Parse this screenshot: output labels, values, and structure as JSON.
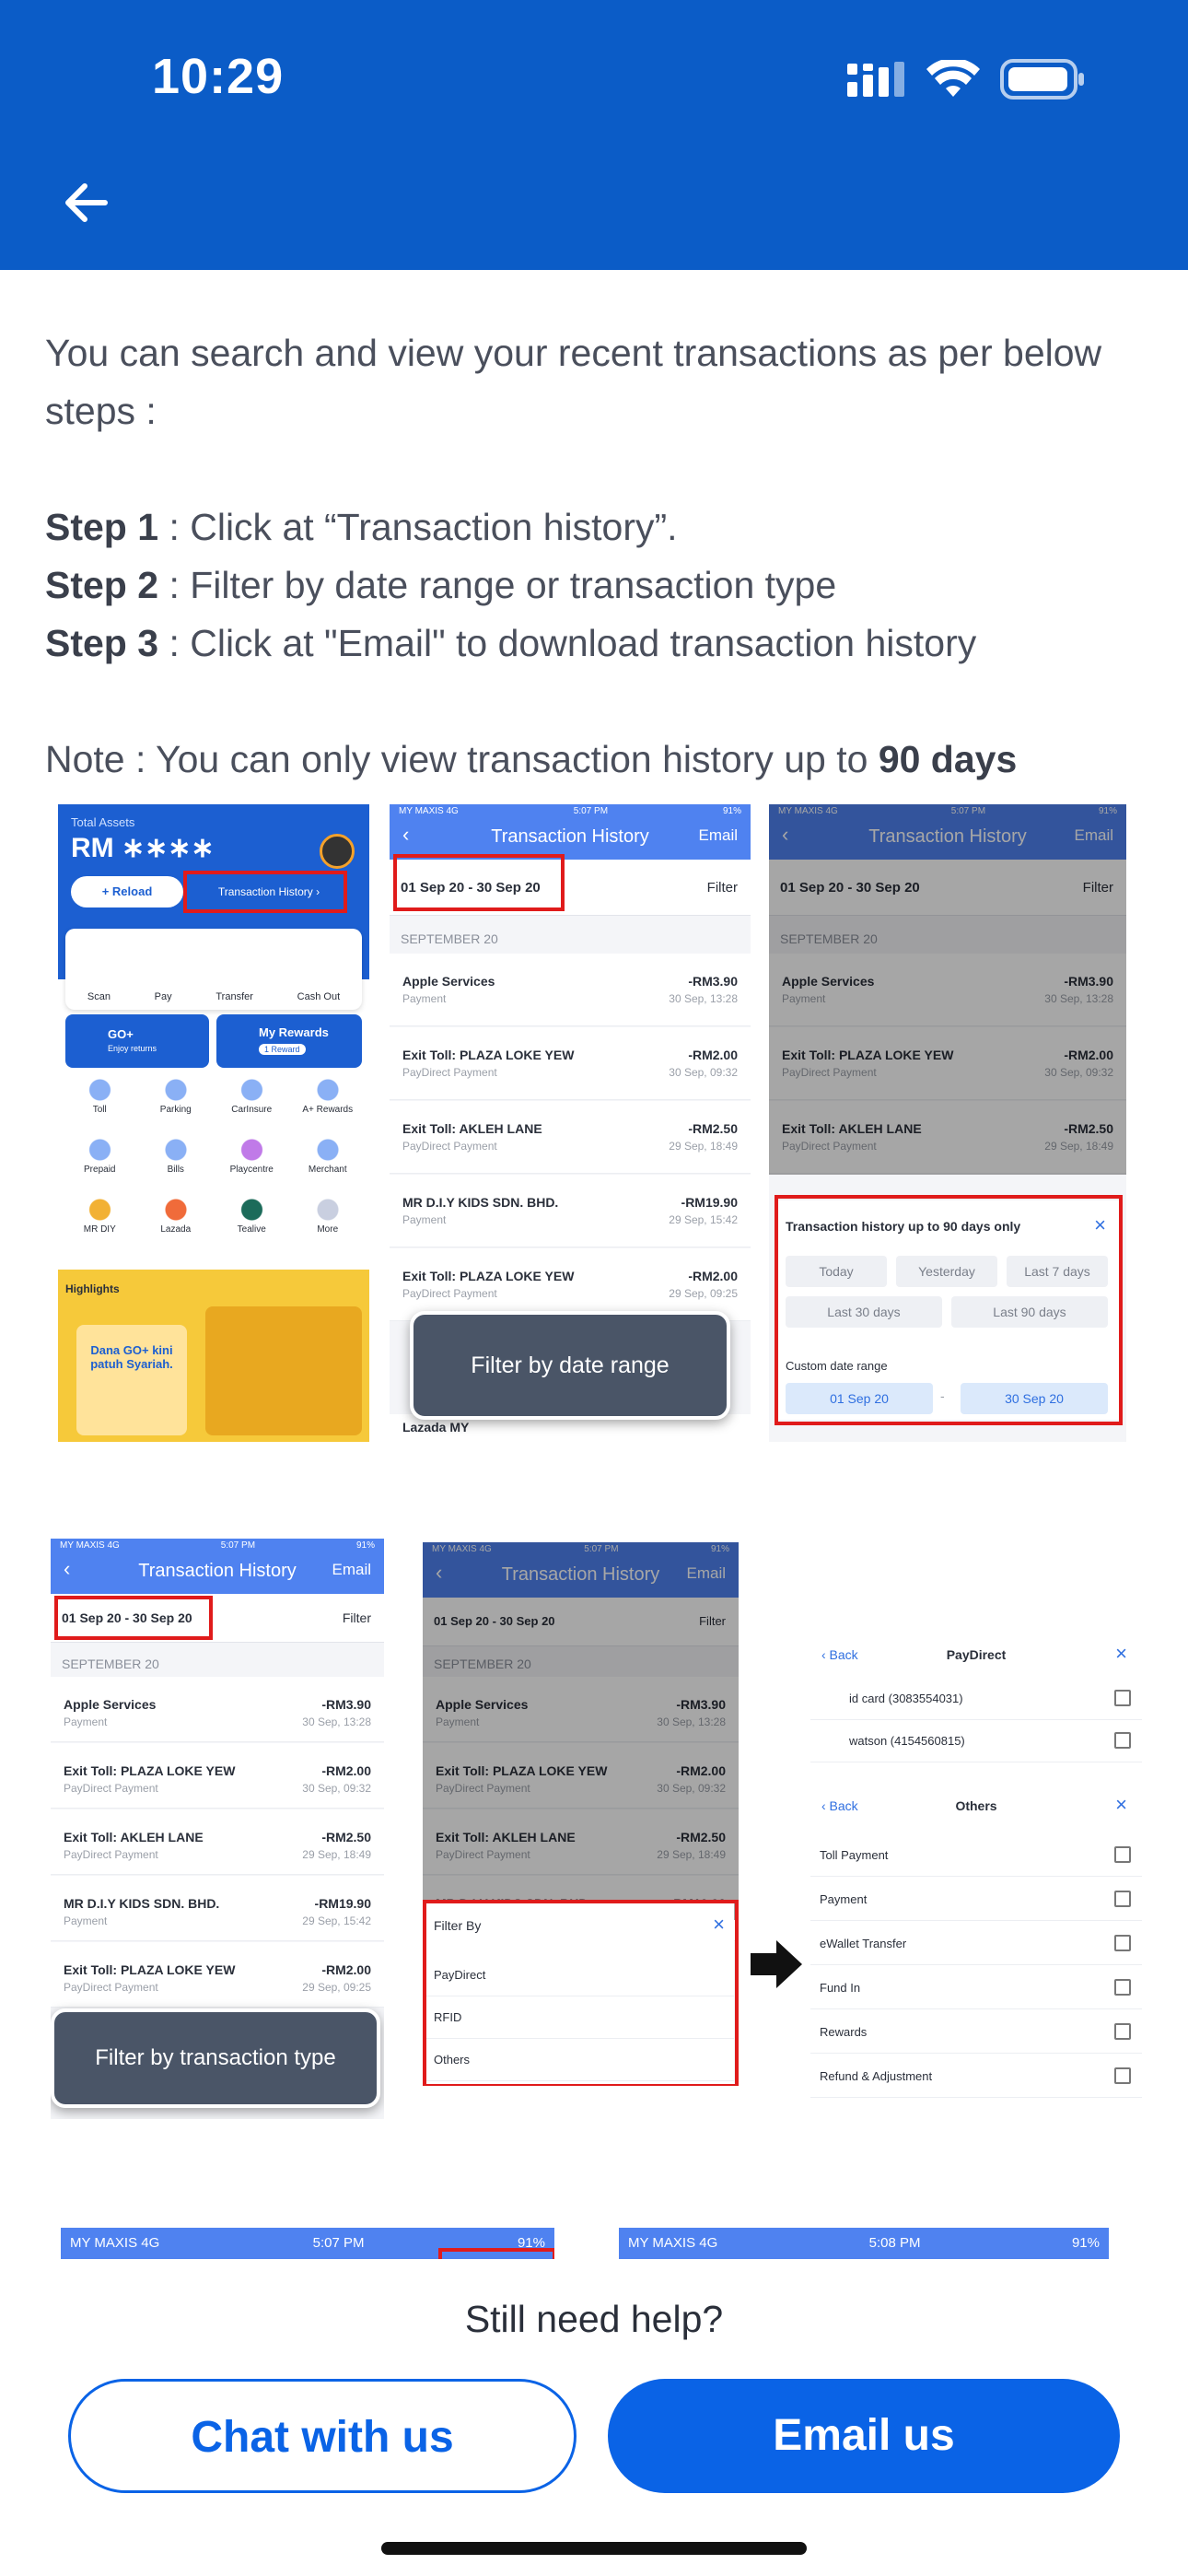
{
  "status_bar": {
    "time": "10:29"
  },
  "intro": "You can search and view your recent transactions as per below steps :",
  "steps": [
    {
      "label": "Step 1",
      "text": " : Click at “Transaction history”."
    },
    {
      "label": "Step 2",
      "text": " : Filter by date range or transaction type"
    },
    {
      "label": "Step 3",
      "text": " : Click at \"Email\" to download transaction history"
    }
  ],
  "note": {
    "text": "Note : You can only view transaction history up to ",
    "bold": "90 days"
  },
  "shot1": {
    "total_assets": "Total Assets",
    "balance": "RM ∗∗∗∗",
    "reload": "+ Reload",
    "history_link": "Transaction History ›",
    "actions": [
      "Scan",
      "Pay",
      "Transfer",
      "Cash Out"
    ],
    "goplus": "GO+",
    "goplus_sub": "Enjoy returns",
    "rewards": "My Rewards",
    "rewards_badge": "1 Reward",
    "grid": [
      "Toll",
      "Parking",
      "CarInsure",
      "A+ Rewards",
      "Prepaid",
      "Bills",
      "Playcentre",
      "Merchant",
      "MR DIY",
      "Lazada",
      "Tealive",
      "More"
    ],
    "highlights": "Highlights",
    "banner": "Dana GO+ kini patuh Syariah."
  },
  "history": {
    "carrier": "MY MAXIS  4G",
    "clock": "5:07 PM",
    "battery": "91%",
    "title": "Transaction History",
    "email": "Email",
    "date_range": "01 Sep 20 - 30 Sep 20",
    "filter": "Filter",
    "section": "SEPTEMBER 20",
    "rows": [
      {
        "name": "Apple Services",
        "sub": "Payment",
        "amount": "-RM3.90",
        "time": "30 Sep, 13:28"
      },
      {
        "name": "Exit Toll: PLAZA LOKE YEW",
        "sub": "PayDirect Payment",
        "amount": "-RM2.00",
        "time": "30 Sep, 09:32"
      },
      {
        "name": "Exit Toll: AKLEH LANE",
        "sub": "PayDirect Payment",
        "amount": "-RM2.50",
        "time": "29 Sep, 18:49"
      },
      {
        "name": "MR D.I.Y KIDS SDN. BHD.",
        "sub": "Payment",
        "amount": "-RM19.90",
        "time": "29 Sep, 15:42"
      },
      {
        "name": "Exit Toll: PLAZA LOKE YEW",
        "sub": "PayDirect Payment",
        "amount": "-RM2.00",
        "time": "29 Sep, 09:25"
      }
    ],
    "partial_row": "Lazada MY"
  },
  "callouts": {
    "date": "Filter by date range",
    "type": "Filter by transaction type"
  },
  "date_panel": {
    "title": "Transaction history up to 90 days only",
    "chips": [
      "Today",
      "Yesterday",
      "Last 7 days",
      "Last 30 days",
      "Last 90 days"
    ],
    "custom": "Custom date range",
    "from": "01 Sep 20",
    "dash": "-",
    "to": "30 Sep 20"
  },
  "filter_panel": {
    "title": "Filter By",
    "options": [
      "PayDirect",
      "RFID",
      "Others"
    ]
  },
  "paydirect_panel": {
    "back": "‹ Back",
    "title": "PayDirect",
    "cards": [
      "id card (3083554031)",
      "watson (4154560815)"
    ]
  },
  "others_panel": {
    "back": "‹ Back",
    "title": "Others",
    "items": [
      "Toll Payment",
      "Payment",
      "eWallet Transfer",
      "Fund In",
      "Rewards",
      "Refund & Adjustment"
    ]
  },
  "peek": {
    "carrier": "MY MAXIS  4G",
    "clock1": "5:07 PM",
    "clock2": "5:08 PM",
    "battery": "91%"
  },
  "help": {
    "question": "Still need help?",
    "chat_label": "Chat with us",
    "email_label": "Email us"
  },
  "colors": {
    "brand": "#0b5cc7",
    "button": "#0a63e6",
    "highlight_red": "#e01b1b"
  }
}
